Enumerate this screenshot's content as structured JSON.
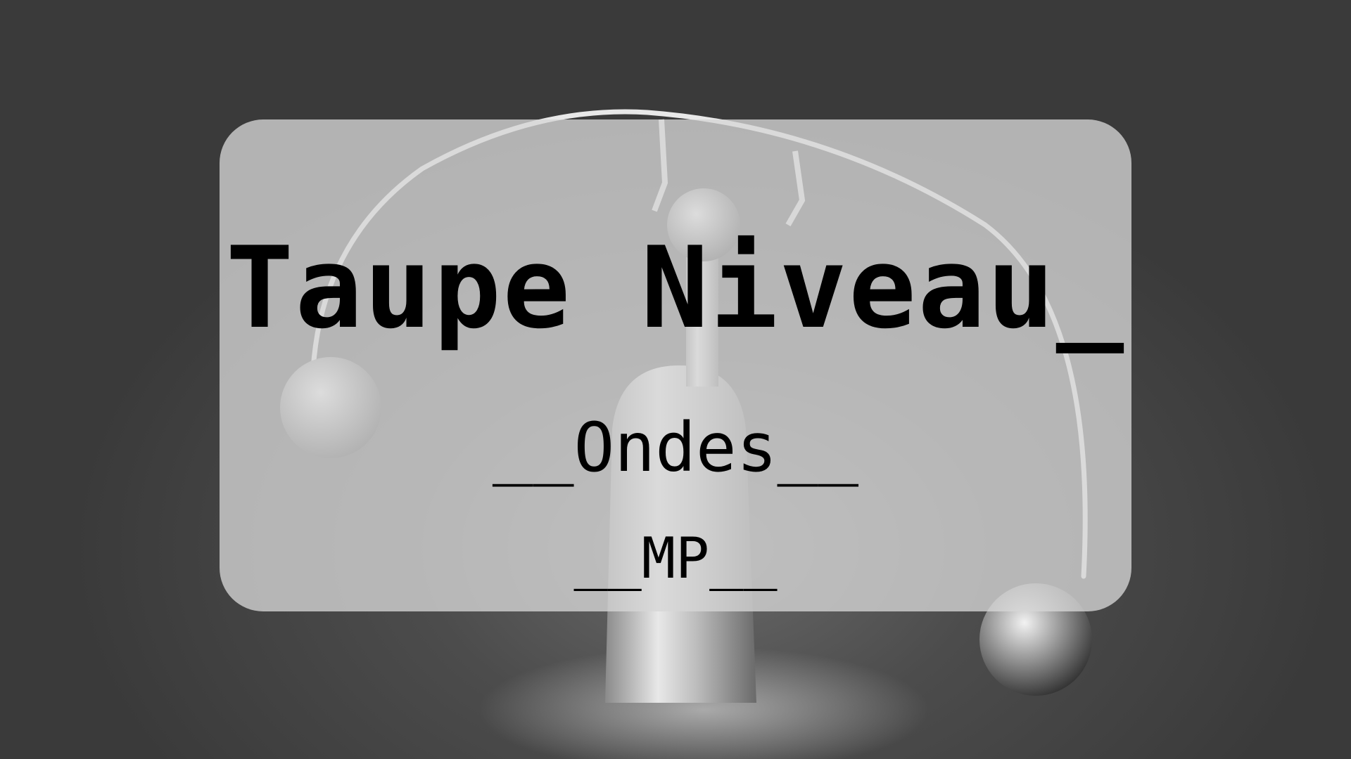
{
  "banner": {
    "title": "Taupe Niveau_",
    "subtitle": "__Ondes__",
    "level": "__MP__"
  },
  "colors": {
    "background": "#4a4a4a",
    "card": "#d6d6d6",
    "text": "#000000"
  },
  "background_image": "balancing-toy-photo"
}
